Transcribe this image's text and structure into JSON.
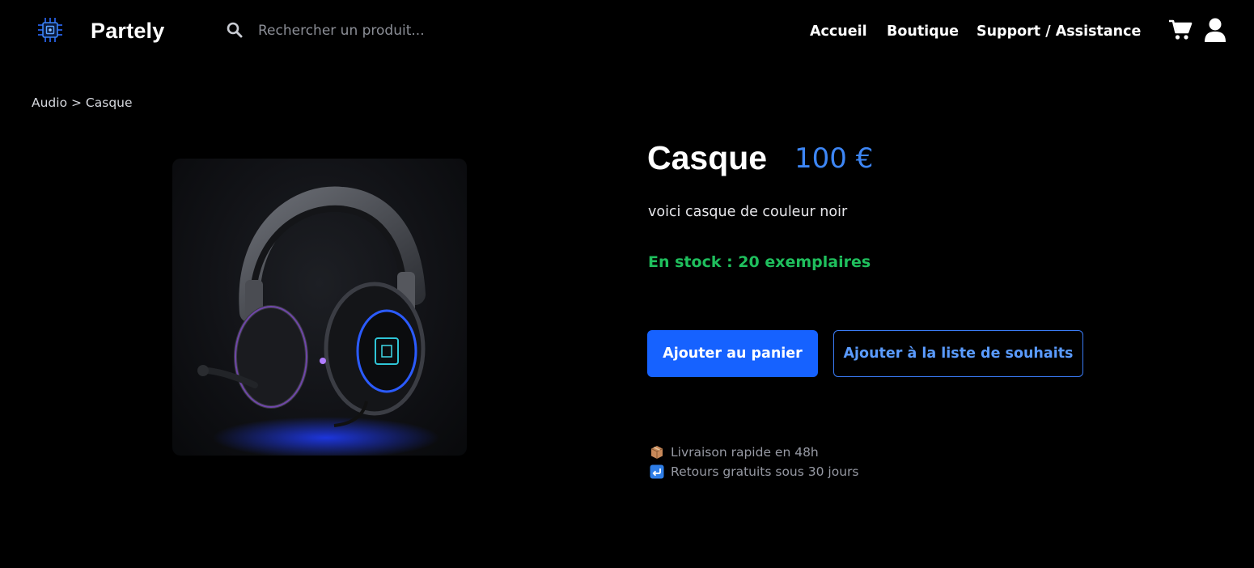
{
  "header": {
    "brand": "Partely",
    "search_placeholder": "Rechercher un produit...",
    "nav": {
      "home": "Accueil",
      "shop": "Boutique",
      "support": "Support / Assistance"
    },
    "icons": {
      "logo": "circuit-chip-icon",
      "search": "search-icon",
      "cart": "cart-icon",
      "user": "user-icon"
    }
  },
  "breadcrumb": {
    "items": [
      "Audio",
      "Casque"
    ],
    "separator": ">"
  },
  "product": {
    "name": "Casque",
    "price": "100 €",
    "description": "voici casque de couleur noir",
    "stock": "En stock : 20 exemplaires",
    "image_icon": "headset-icon"
  },
  "actions": {
    "add_to_cart": "Ajouter au panier",
    "add_to_wishlist": "Ajouter à la liste de souhaits"
  },
  "perks": [
    {
      "icon": "package-icon",
      "text": "Livraison rapide en 48h"
    },
    {
      "icon": "return-arrow-icon",
      "text": "Retours gratuits sous 30 jours"
    }
  ],
  "colors": {
    "background": "#000000",
    "accent": "#1662ff",
    "price": "#3d86f5",
    "stock": "#1fbf5d",
    "muted_text": "#9699a3"
  }
}
